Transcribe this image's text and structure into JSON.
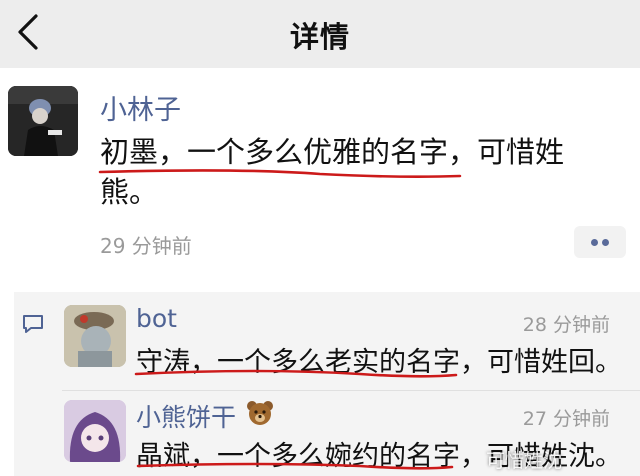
{
  "header": {
    "title": "详情"
  },
  "post": {
    "author": "小林子",
    "content": "初墨，一个多么优雅的名字，可惜姓熊。",
    "time": "29 分钟前"
  },
  "comments": [
    {
      "author": "bot",
      "time": "28 分钟前",
      "text": "守涛，一个多么老实的名字，可惜姓回。"
    },
    {
      "author": "小熊饼干",
      "time": "27 分钟前",
      "text": "晶斌，一个多么婉约的名字，可惜姓沈。"
    }
  ],
  "watermark": "可惜姓沈",
  "colors": {
    "name": "#4f6394",
    "underline": "#cc1a1a",
    "meta": "#9a9a9a"
  },
  "icons": {
    "back": "chevron-left-icon",
    "more": "more-dots-icon",
    "comment": "comment-icon",
    "bear": "bear-emoji-icon"
  }
}
